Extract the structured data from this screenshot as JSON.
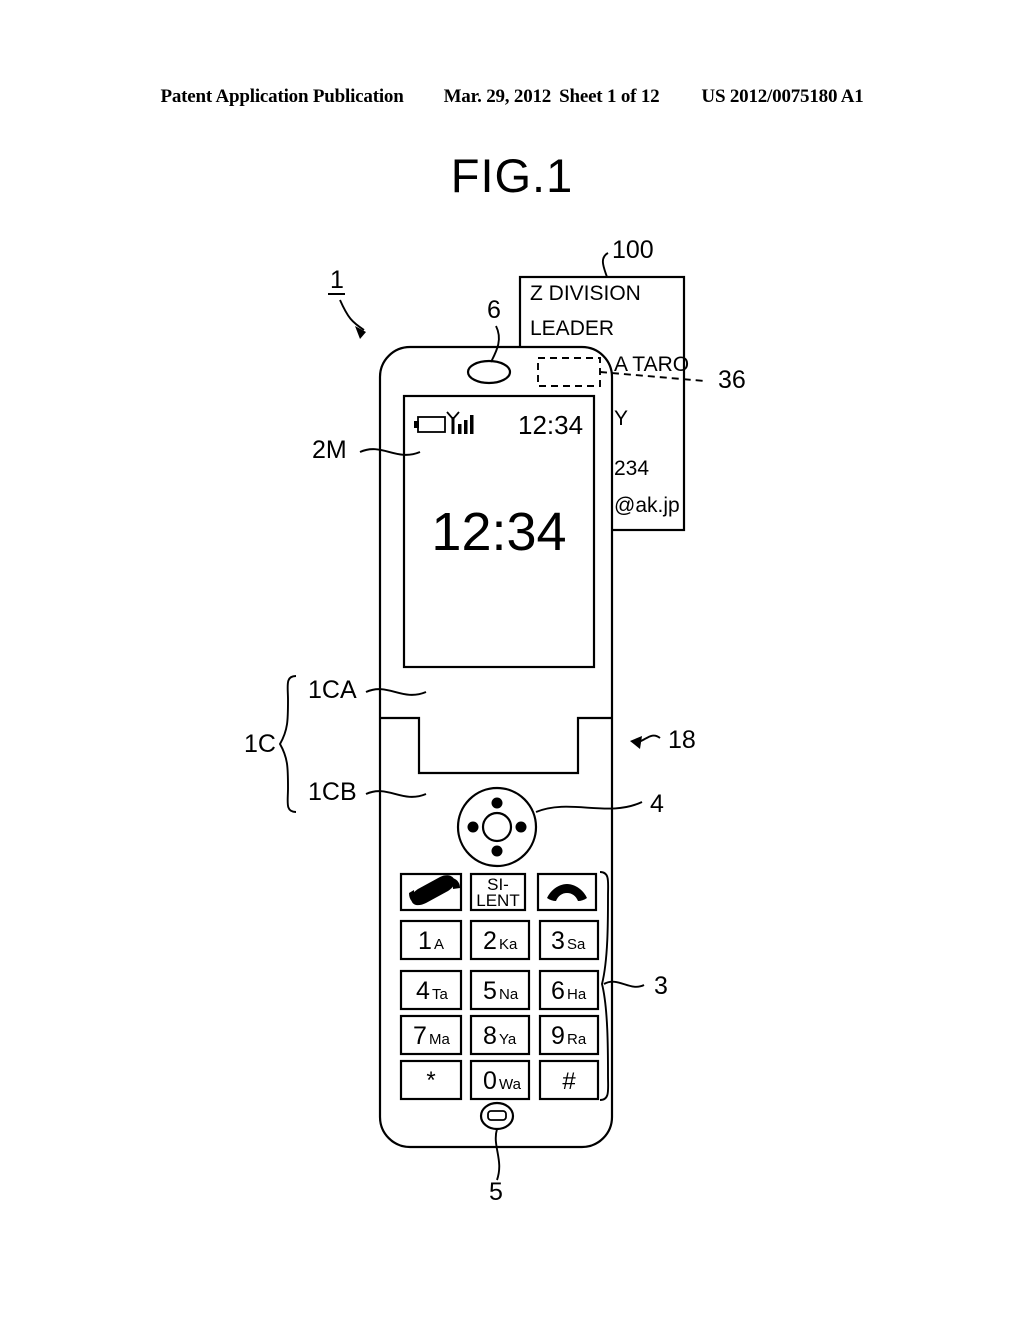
{
  "header": {
    "publication": "Patent Application Publication",
    "date": "Mar. 29, 2012",
    "sheet": "Sheet 1 of 12",
    "doc_number": "US 2012/0075180 A1"
  },
  "figure": {
    "title": "FIG.1"
  },
  "reference_numerals": {
    "device": "1",
    "keypad": "3",
    "nav_key": "4",
    "bottom_key": "5",
    "earpiece": "6",
    "hinge": "18",
    "display": "2M",
    "housing": "1C",
    "upper_housing": "1CA",
    "lower_housing": "1CB",
    "card": "100",
    "reader_area": "36"
  },
  "card": {
    "lines": [
      "Z DIVISION",
      "LEADER",
      "A TARO",
      "Y",
      "234",
      "@ak.jp"
    ]
  },
  "screen": {
    "status_time": "12:34",
    "clock": "12:34",
    "battery_icon": "battery-icon",
    "signal_icon": "signal-bars-icon"
  },
  "keypad": {
    "function_row": [
      {
        "label": "",
        "icon": "call-handset-icon",
        "name": "call-key"
      },
      {
        "label": "SI-\nLENT",
        "line1": "SI-",
        "line2": "LENT",
        "icon": "",
        "name": "silent-key"
      },
      {
        "label": "",
        "icon": "end-call-handset-icon",
        "name": "end-call-key"
      }
    ],
    "number_keys": [
      {
        "digit": "1",
        "kana": "A"
      },
      {
        "digit": "2",
        "kana": "Ka"
      },
      {
        "digit": "3",
        "kana": "Sa"
      },
      {
        "digit": "4",
        "kana": "Ta"
      },
      {
        "digit": "5",
        "kana": "Na"
      },
      {
        "digit": "6",
        "kana": "Ha"
      },
      {
        "digit": "7",
        "kana": "Ma"
      },
      {
        "digit": "8",
        "kana": "Ya"
      },
      {
        "digit": "9",
        "kana": "Ra"
      },
      {
        "digit": "*",
        "kana": ""
      },
      {
        "digit": "0",
        "kana": "Wa"
      },
      {
        "digit": "#",
        "kana": ""
      }
    ]
  },
  "colors": {
    "line": "#000000",
    "background": "#ffffff"
  }
}
